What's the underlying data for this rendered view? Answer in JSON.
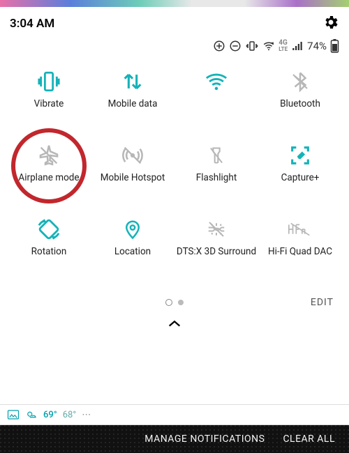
{
  "statusbar": {
    "time": "3:04 AM",
    "battery_percent": "74%",
    "network": "4G LTE",
    "icons": [
      "add-circle",
      "dnd",
      "vibrate",
      "wifi-signal",
      "4g-lte",
      "cell-signal",
      "battery"
    ]
  },
  "tiles": [
    {
      "name": "vibrate",
      "label": "Vibrate",
      "active": true
    },
    {
      "name": "mobile-data",
      "label": "Mobile data",
      "active": true
    },
    {
      "name": "wifi",
      "label": "",
      "active": true
    },
    {
      "name": "bluetooth",
      "label": "Bluetooth",
      "active": false
    },
    {
      "name": "airplane",
      "label": "Airplane mode",
      "active": false,
      "highlighted": true
    },
    {
      "name": "hotspot",
      "label": "Mobile Hotspot",
      "active": false
    },
    {
      "name": "flashlight",
      "label": "Flashlight",
      "active": false
    },
    {
      "name": "capture",
      "label": "Capture+",
      "active": true
    },
    {
      "name": "rotation",
      "label": "Rotation",
      "active": true
    },
    {
      "name": "location",
      "label": "Location",
      "active": true
    },
    {
      "name": "dtsx",
      "label": "DTS:X 3D Surround",
      "active": false
    },
    {
      "name": "hifi",
      "label": "Hi-Fi Quad DAC",
      "active": false
    }
  ],
  "pager": {
    "page": 1,
    "total": 2
  },
  "edit_label": "EDIT",
  "weather": {
    "hi": "69°",
    "lo": "68°"
  },
  "bottom": {
    "manage": "MANAGE NOTIFICATIONS",
    "clear": "CLEAR ALL"
  }
}
